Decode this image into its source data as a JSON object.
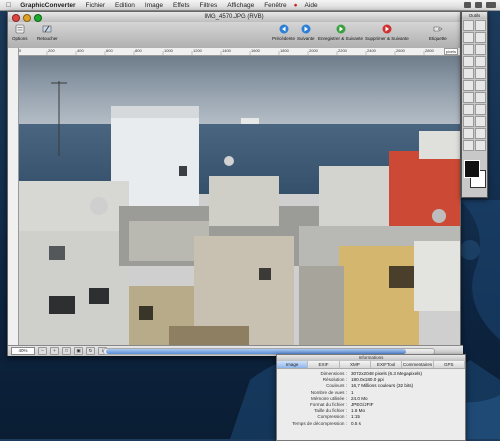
{
  "menubar": {
    "app_name": "GraphicConverter",
    "items": [
      "Fichier",
      "Edition",
      "Image",
      "Effets",
      "Filtres",
      "Affichage",
      "Fenêtre",
      "Aide"
    ]
  },
  "window": {
    "title": "IMG_4570.JPG (RVB)",
    "toolbar": {
      "left": [
        {
          "label": "Options",
          "icon": "options-icon"
        },
        {
          "label": "Retoucher",
          "icon": "retouch-icon"
        }
      ],
      "right": [
        {
          "label": "Précédente",
          "icon": "arrow-left-icon"
        },
        {
          "label": "Suivante",
          "icon": "arrow-right-icon"
        },
        {
          "label": "Enregistrer & Suivante",
          "icon": "save-next-icon"
        },
        {
          "label": "Supprimer & Suivante",
          "icon": "delete-next-icon"
        },
        {
          "label": "Etiquette",
          "icon": "label-icon"
        }
      ]
    },
    "ruler_units": "pixels",
    "ruler_ticks": [
      "0",
      "200",
      "400",
      "600",
      "800",
      "1000",
      "1200",
      "1400",
      "1600",
      "1800",
      "2000",
      "2200",
      "2400",
      "2600",
      "2800",
      "3000"
    ],
    "zoom_value": "40%"
  },
  "tools_palette": {
    "title": "Outils",
    "tools": [
      "selection-icon",
      "lasso-icon",
      "wand-icon",
      "move-icon",
      "pencil-icon",
      "brush-icon",
      "eraser-icon",
      "bucket-icon",
      "text-icon",
      "line-icon",
      "rect-icon",
      "oval-icon",
      "stamp-icon",
      "dropper-icon",
      "zoom-icon",
      "hand-icon",
      "blur-icon",
      "sharpen-icon",
      "dodge-icon",
      "burn-icon",
      "gradient-icon",
      "spray-icon",
      "crop-icon",
      "measure-icon"
    ],
    "foreground": "#111111",
    "background": "#ffffff"
  },
  "info_window": {
    "title": "Informations",
    "tabs": [
      "Image",
      "EXIF",
      "XMP",
      "EXIFTool",
      "Commentaires",
      "GPS"
    ],
    "active_tab": "Image",
    "rows": [
      {
        "label": "Dimensions :",
        "value": "3072x2048 pixels (6.3 Megapixels)"
      },
      {
        "label": "Résolution :",
        "value": "180.0x180.0 ppi"
      },
      {
        "label": "Couleurs :",
        "value": "16,7 Millions couleurs (32 bits)"
      },
      {
        "label": "Nombre de vues :",
        "value": "1"
      },
      {
        "label": "Mémoire utilisée :",
        "value": "24.0 Mo"
      },
      {
        "label": "Format du fichier :",
        "value": "JPEG/JFIF"
      },
      {
        "label": "Taille du fichier :",
        "value": "1.6 Mo"
      },
      {
        "label": "Compression :",
        "value": "1:15"
      },
      {
        "label": "Temps de décompression :",
        "value": "0.5 s"
      }
    ]
  },
  "colors": {
    "desktop": "#143050",
    "toolbar_green": "#3aa040",
    "toolbar_red": "#d23030",
    "toolbar_blue": "#2a7fd8",
    "active_tab": "#8fb5ea"
  }
}
